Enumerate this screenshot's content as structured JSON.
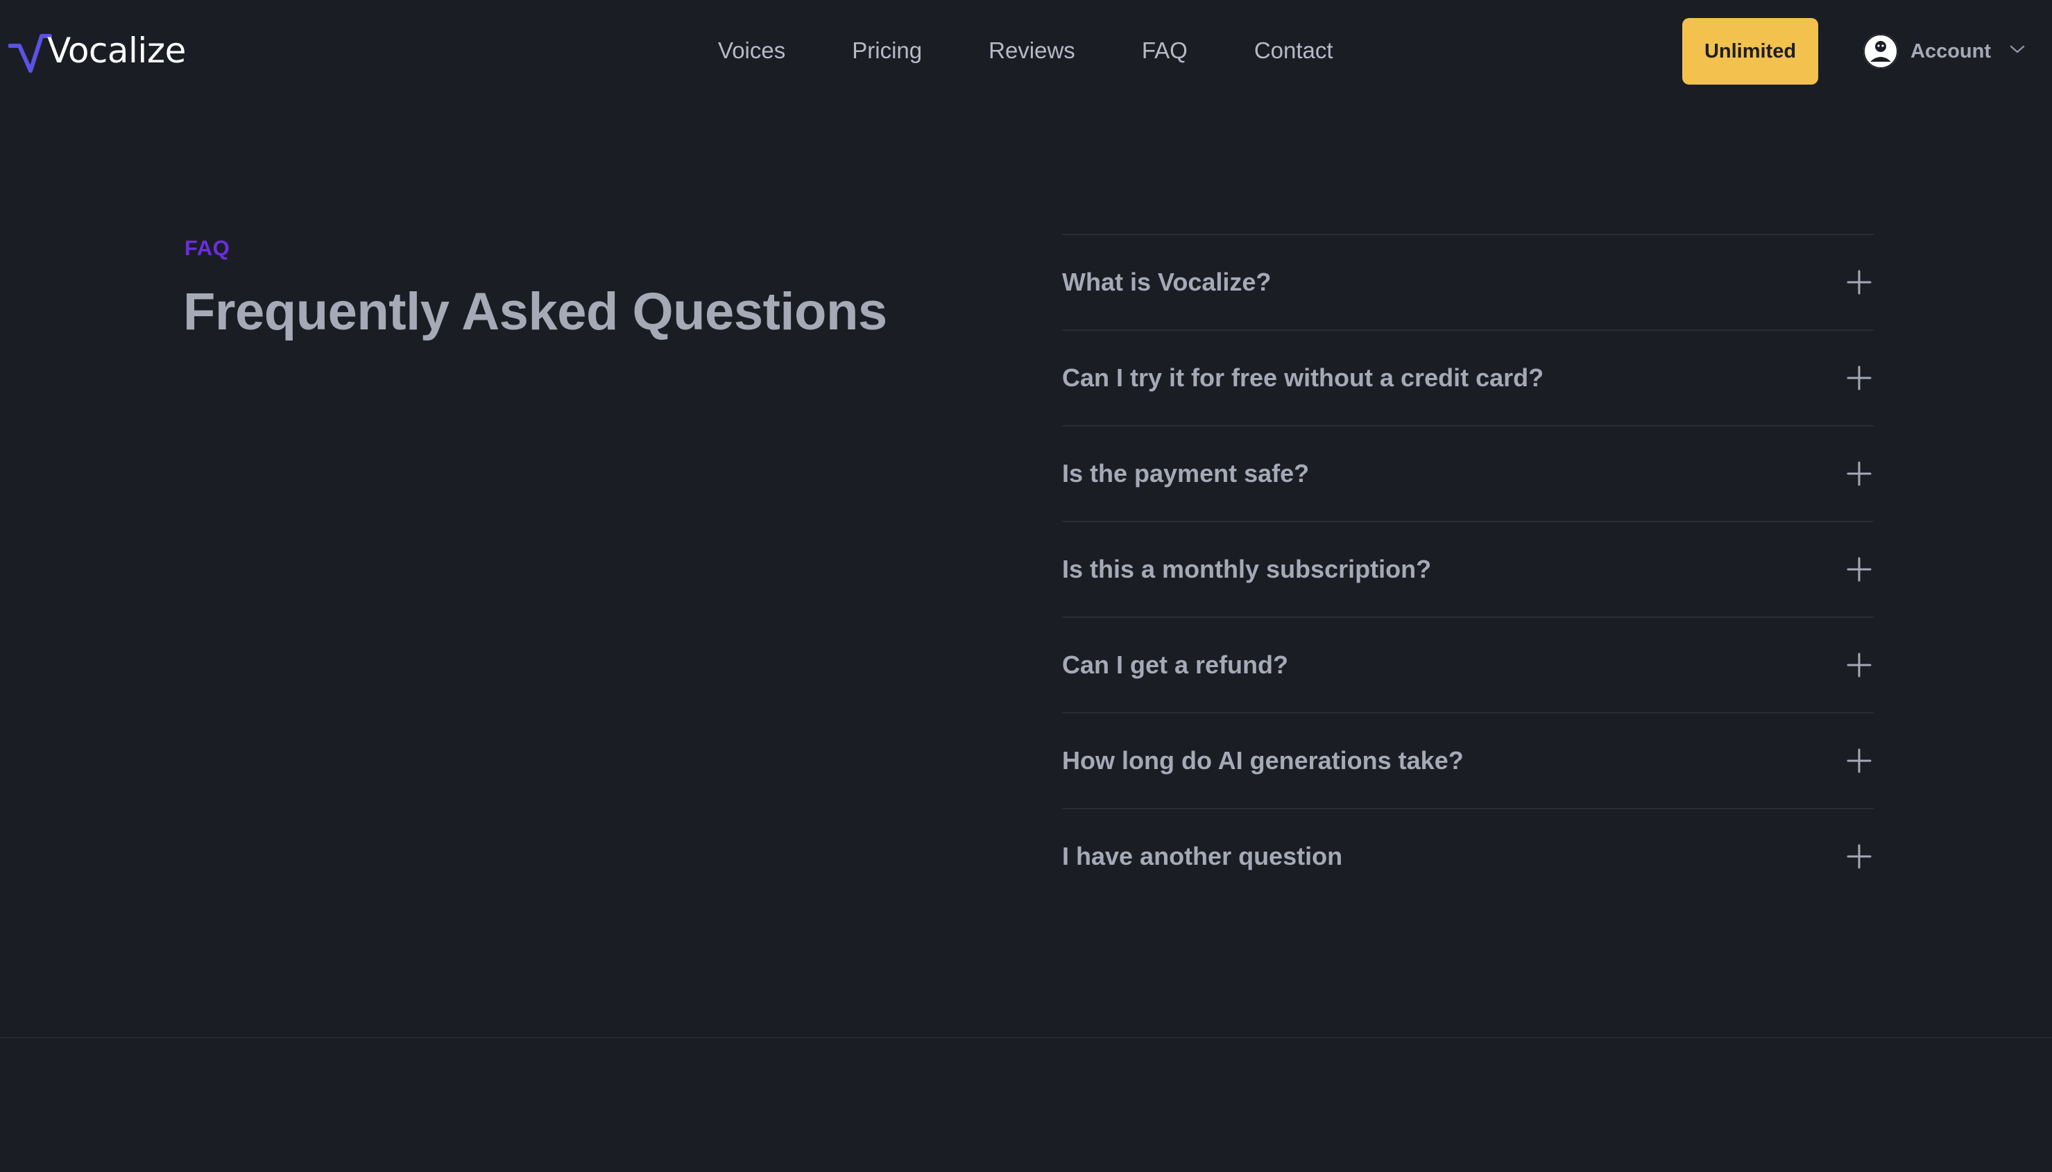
{
  "brand": {
    "name": "Vocalize",
    "logo_icon": "waveform-v-icon",
    "accent_color": "#6a2fe0",
    "cta_color": "#f2c14e",
    "background_color": "#1b1d25"
  },
  "nav": {
    "items": [
      {
        "label": "Voices"
      },
      {
        "label": "Pricing"
      },
      {
        "label": "Reviews"
      },
      {
        "label": "FAQ"
      },
      {
        "label": "Contact"
      }
    ],
    "cta_label": "Unlimited",
    "account_label": "Account",
    "account_icon": "avatar-icon",
    "dropdown_icon": "chevron-down-icon"
  },
  "faq": {
    "eyebrow": "FAQ",
    "title": "Frequently Asked Questions",
    "expand_icon": "plus-icon",
    "items": [
      {
        "question": "What is Vocalize?"
      },
      {
        "question": "Can I try it for free without a credit card?"
      },
      {
        "question": "Is the payment safe?"
      },
      {
        "question": "Is this a monthly subscription?"
      },
      {
        "question": "Can I get a refund?"
      },
      {
        "question": "How long do AI generations take?"
      },
      {
        "question": "I have another question"
      }
    ]
  }
}
